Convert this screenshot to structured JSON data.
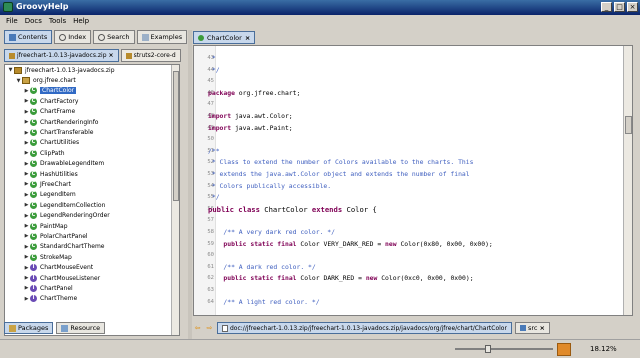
{
  "app": {
    "title": "GroovyHelp"
  },
  "menu": [
    "File",
    "Docs",
    "Tools",
    "Help"
  ],
  "left": {
    "tabs": [
      {
        "label": "Contents",
        "active": true
      },
      {
        "label": "Index",
        "active": false
      },
      {
        "label": "Search",
        "active": false
      },
      {
        "label": "Examples",
        "active": false
      }
    ],
    "doc_tabs": [
      {
        "label": "jfreechart-1.0.13-javadocs.zip",
        "active": true
      },
      {
        "label": "struts2-core-d",
        "active": false
      }
    ],
    "tree": [
      {
        "label": "jfreechart-1.0.13-javadocs.zip",
        "kind": "zip",
        "level": 0,
        "expanded": true
      },
      {
        "label": "org.jfree.chart",
        "kind": "pkg",
        "level": 1,
        "expanded": true
      },
      {
        "label": "ChartColor",
        "kind": "c",
        "level": 2,
        "selected": true
      },
      {
        "label": "ChartFactory",
        "kind": "c",
        "level": 2
      },
      {
        "label": "ChartFrame",
        "kind": "c",
        "level": 2
      },
      {
        "label": "ChartRenderingInfo",
        "kind": "c",
        "level": 2
      },
      {
        "label": "ChartTransferable",
        "kind": "c",
        "level": 2
      },
      {
        "label": "ChartUtilities",
        "kind": "c",
        "level": 2
      },
      {
        "label": "ClipPath",
        "kind": "c",
        "level": 2
      },
      {
        "label": "DrawableLegendItem",
        "kind": "c",
        "level": 2
      },
      {
        "label": "HashUtilities",
        "kind": "c",
        "level": 2
      },
      {
        "label": "JFreeChart",
        "kind": "c",
        "level": 2
      },
      {
        "label": "LegendItem",
        "kind": "c",
        "level": 2
      },
      {
        "label": "LegendItemCollection",
        "kind": "c",
        "level": 2
      },
      {
        "label": "LegendRenderingOrder",
        "kind": "c",
        "level": 2
      },
      {
        "label": "PaintMap",
        "kind": "c",
        "level": 2
      },
      {
        "label": "PolarChartPanel",
        "kind": "c",
        "level": 2
      },
      {
        "label": "StandardChartTheme",
        "kind": "c",
        "level": 2
      },
      {
        "label": "StrokeMap",
        "kind": "c",
        "level": 2
      },
      {
        "label": "ChartMouseEvent",
        "kind": "i",
        "level": 2
      },
      {
        "label": "ChartMouseListener",
        "kind": "i",
        "level": 2
      },
      {
        "label": "ChartPanel",
        "kind": "i",
        "level": 2
      },
      {
        "label": "ChartTheme",
        "kind": "i",
        "level": 2
      }
    ],
    "bottom_tabs": [
      {
        "label": "Packages",
        "active": true
      },
      {
        "label": "Resource",
        "active": false
      }
    ]
  },
  "editor": {
    "tab_label": "ChartColor",
    "lines": [
      {
        "n": "43",
        "parts": [
          {
            "t": " *",
            "c": "cm"
          }
        ]
      },
      {
        "n": "44",
        "parts": [
          {
            "t": " */",
            "c": "cm"
          }
        ]
      },
      {
        "n": "45",
        "parts": [
          {
            "t": "",
            "c": ""
          }
        ]
      },
      {
        "n": "46",
        "parts": [
          {
            "t": "package",
            "c": "kw"
          },
          {
            "t": " org.jfree.chart;",
            "c": ""
          }
        ]
      },
      {
        "n": "47",
        "parts": [
          {
            "t": "",
            "c": ""
          }
        ]
      },
      {
        "n": "48",
        "parts": [
          {
            "t": "import",
            "c": "kw"
          },
          {
            "t": " java.awt.Color;",
            "c": ""
          }
        ]
      },
      {
        "n": "49",
        "parts": [
          {
            "t": "import",
            "c": "kw"
          },
          {
            "t": " java.awt.Paint;",
            "c": ""
          }
        ]
      },
      {
        "n": "50",
        "parts": [
          {
            "t": "",
            "c": ""
          }
        ]
      },
      {
        "n": "51",
        "parts": [
          {
            "t": "/**",
            "c": "cm"
          }
        ]
      },
      {
        "n": "52",
        "parts": [
          {
            "t": " * Class to extend the number of Colors available to the charts. This",
            "c": "cm"
          }
        ]
      },
      {
        "n": "53",
        "parts": [
          {
            "t": " * extends the java.awt.Color object and extends the number of final",
            "c": "cm"
          }
        ]
      },
      {
        "n": "54",
        "parts": [
          {
            "t": " * Colors publically accessible.",
            "c": "cm"
          }
        ]
      },
      {
        "n": "55",
        "parts": [
          {
            "t": " */",
            "c": "cm"
          }
        ]
      },
      {
        "n": "56",
        "parts": [
          {
            "t": "public",
            "c": "kw"
          },
          {
            "t": " ",
            "c": ""
          },
          {
            "t": "class",
            "c": "kw"
          },
          {
            "t": " ChartColor ",
            "c": ""
          },
          {
            "t": "extends",
            "c": "kw"
          },
          {
            "t": " Color {",
            "c": ""
          }
        ],
        "big": true
      },
      {
        "n": "57",
        "parts": [
          {
            "t": "",
            "c": ""
          }
        ]
      },
      {
        "n": "58",
        "parts": [
          {
            "t": "    /** A very dark red color. */",
            "c": "cm"
          }
        ]
      },
      {
        "n": "59",
        "parts": [
          {
            "t": "    ",
            "c": ""
          },
          {
            "t": "public",
            "c": "kw"
          },
          {
            "t": " ",
            "c": ""
          },
          {
            "t": "static",
            "c": "kw"
          },
          {
            "t": " ",
            "c": ""
          },
          {
            "t": "final",
            "c": "kw"
          },
          {
            "t": " Color VERY_DARK_RED = ",
            "c": ""
          },
          {
            "t": "new",
            "c": "kw"
          },
          {
            "t": " Color(0x80, 0x00, 0x00);",
            "c": ""
          }
        ]
      },
      {
        "n": "60",
        "parts": [
          {
            "t": "",
            "c": ""
          }
        ]
      },
      {
        "n": "61",
        "parts": [
          {
            "t": "    /** A dark red color. */",
            "c": "cm"
          }
        ]
      },
      {
        "n": "62",
        "parts": [
          {
            "t": "    ",
            "c": ""
          },
          {
            "t": "public",
            "c": "kw"
          },
          {
            "t": " ",
            "c": ""
          },
          {
            "t": "static",
            "c": "kw"
          },
          {
            "t": " ",
            "c": ""
          },
          {
            "t": "final",
            "c": "kw"
          },
          {
            "t": " Color DARK_RED = ",
            "c": ""
          },
          {
            "t": "new",
            "c": "kw"
          },
          {
            "t": " Color(0xc0, 0x00, 0x00);",
            "c": ""
          }
        ]
      },
      {
        "n": "63",
        "parts": [
          {
            "t": "",
            "c": ""
          }
        ]
      },
      {
        "n": "64",
        "parts": [
          {
            "t": "    /** A light red color. */",
            "c": "cm"
          }
        ]
      }
    ]
  },
  "pathbar": {
    "path": "doc://jfreechart-1.0.13.zip/jfreechart-1.0.13-javadocs.zip/javadocs/org/jfree/chart/ChartColor",
    "src_label": "src"
  },
  "status": {
    "zoom_text": "18.12%"
  }
}
